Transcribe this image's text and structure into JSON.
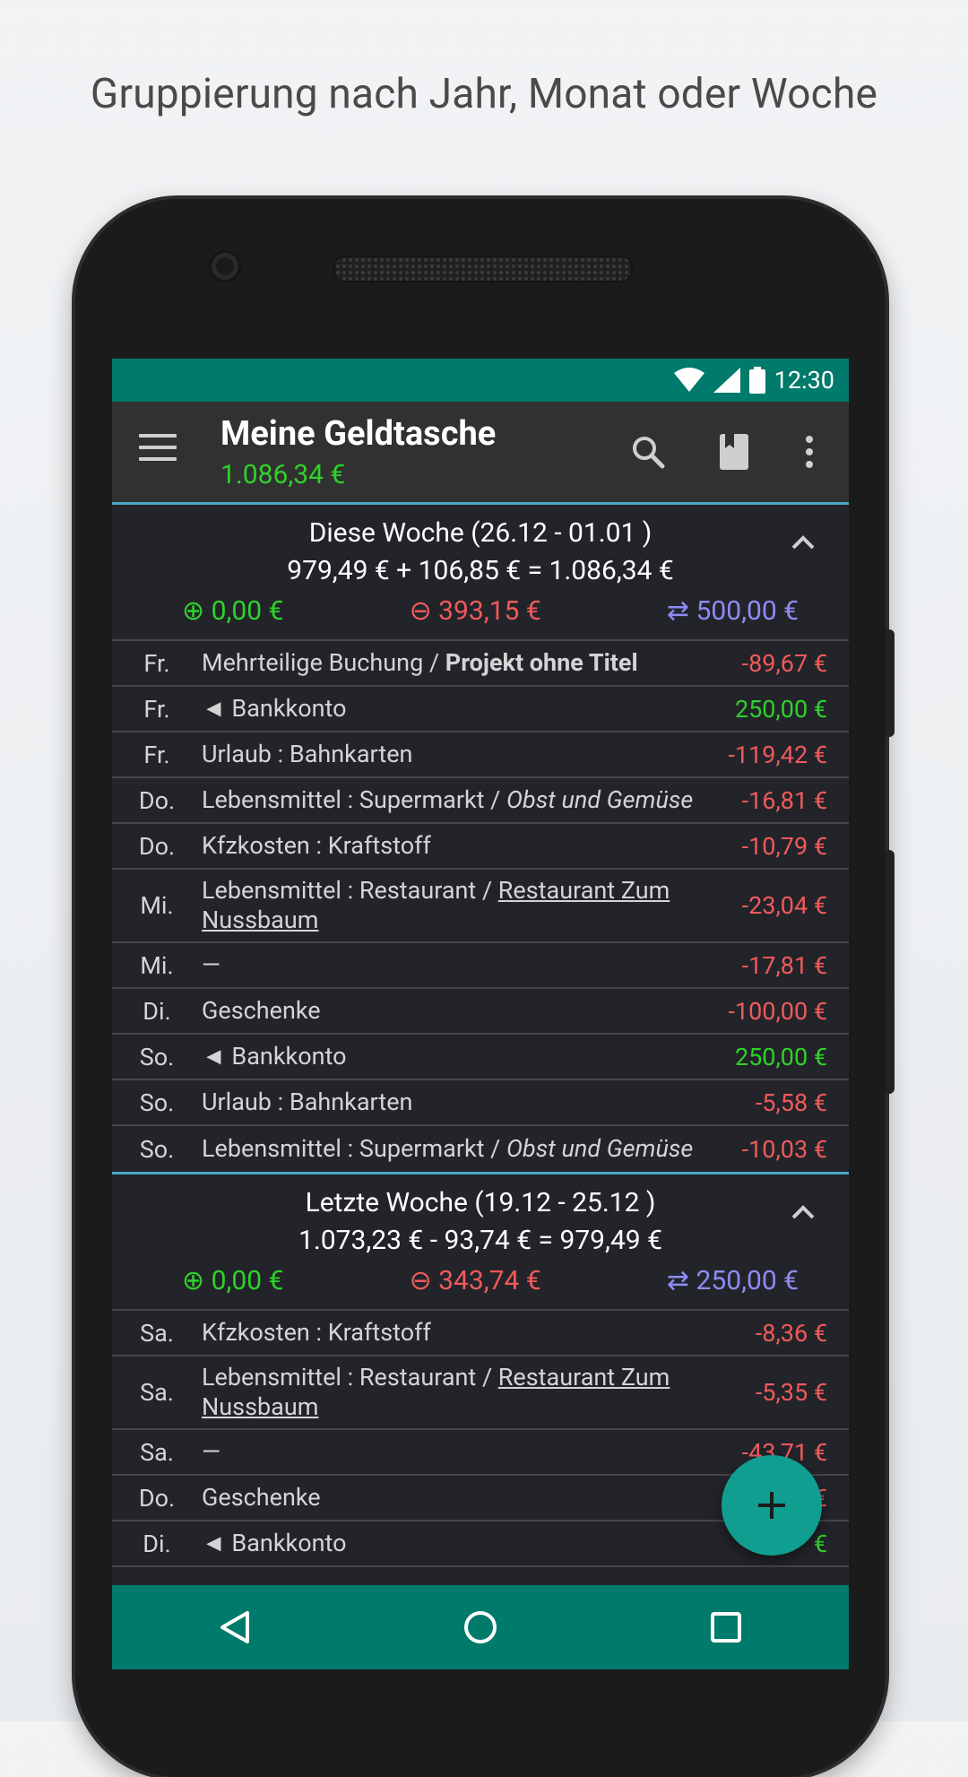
{
  "caption": "Gruppierung nach Jahr, Monat oder Woche",
  "status": {
    "time": "12:30",
    "icons": [
      "wifi-icon",
      "signal-icon",
      "battery-icon"
    ]
  },
  "appbar": {
    "title": "Meine Geldtasche",
    "balance": "1.086,34 €",
    "icons": [
      "menu-icon",
      "search-icon",
      "book-icon",
      "more-icon"
    ]
  },
  "groups": [
    {
      "title": "Diese Woche (26.12 - 01.01 )",
      "summary": "979,49 € + 106,85 € = 1.086,34 €",
      "income": "⊕ 0,00 €",
      "expense": "⊖ 393,15 €",
      "transfer": "⇄ 500,00 €",
      "rows": [
        {
          "day": "Fr.",
          "desc": "Mehrteilige Buchung / ",
          "desc_extra": "Projekt ohne Titel",
          "extra_style": "bold",
          "amount": "-89,67 €",
          "color": "red"
        },
        {
          "day": "Fr.",
          "desc": "◄ Bankkonto",
          "amount": "250,00 €",
          "color": "green"
        },
        {
          "day": "Fr.",
          "desc": "Urlaub : Bahnkarten",
          "amount": "-119,42 €",
          "color": "red"
        },
        {
          "day": "Do.",
          "desc": "Lebensmittel : Supermarkt / ",
          "desc_extra": "Obst und Gemüse",
          "extra_style": "italic",
          "amount": "-16,81 €",
          "color": "red"
        },
        {
          "day": "Do.",
          "desc": "Kfzkosten : Kraftstoff",
          "amount": "-10,79 €",
          "color": "red"
        },
        {
          "day": "Mi.",
          "desc": "Lebensmittel : Restaurant / ",
          "desc_extra": "Restaurant Zum Nussbaum",
          "extra_style": "underline",
          "amount": "-23,04 €",
          "color": "red"
        },
        {
          "day": "Mi.",
          "desc": "—",
          "amount": "-17,81 €",
          "color": "red"
        },
        {
          "day": "Di.",
          "desc": "Geschenke",
          "amount": "-100,00 €",
          "color": "red"
        },
        {
          "day": "So.",
          "desc": "◄ Bankkonto",
          "amount": "250,00 €",
          "color": "green"
        },
        {
          "day": "So.",
          "desc": "Urlaub : Bahnkarten",
          "amount": "-5,58 €",
          "color": "red"
        },
        {
          "day": "So.",
          "desc": "Lebensmittel : Supermarkt / ",
          "desc_extra": "Obst und Gemüse",
          "extra_style": "italic",
          "amount": "-10,03 €",
          "color": "red"
        }
      ]
    },
    {
      "title": "Letzte Woche (19.12 - 25.12 )",
      "summary": "1.073,23 € - 93,74 € = 979,49 €",
      "income": "⊕ 0,00 €",
      "expense": "⊖ 343,74 €",
      "transfer": "⇄ 250,00 €",
      "rows": [
        {
          "day": "Sa.",
          "desc": "Kfzkosten : Kraftstoff",
          "amount": "-8,36 €",
          "color": "red"
        },
        {
          "day": "Sa.",
          "desc": "Lebensmittel : Restaurant / ",
          "desc_extra": "Restaurant Zum Nussbaum",
          "extra_style": "underline",
          "amount": "-5,35 €",
          "color": "red"
        },
        {
          "day": "Sa.",
          "desc": "—",
          "amount": "-43,71 €",
          "color": "red"
        },
        {
          "day": "Do.",
          "desc": "Geschenke",
          "amount": "€",
          "color": "red"
        },
        {
          "day": "Di.",
          "desc": "◄ Bankkonto",
          "amount": "€",
          "color": "green"
        }
      ]
    }
  ],
  "colors": {
    "teal": "#007a6a",
    "green": "#2fd12a",
    "red": "#f05a5a",
    "blue": "#8c8cf5",
    "fab": "#0f9e8f"
  },
  "navbar": [
    "back-icon",
    "home-icon",
    "recents-icon"
  ],
  "fab": {
    "icon": "plus-icon"
  }
}
